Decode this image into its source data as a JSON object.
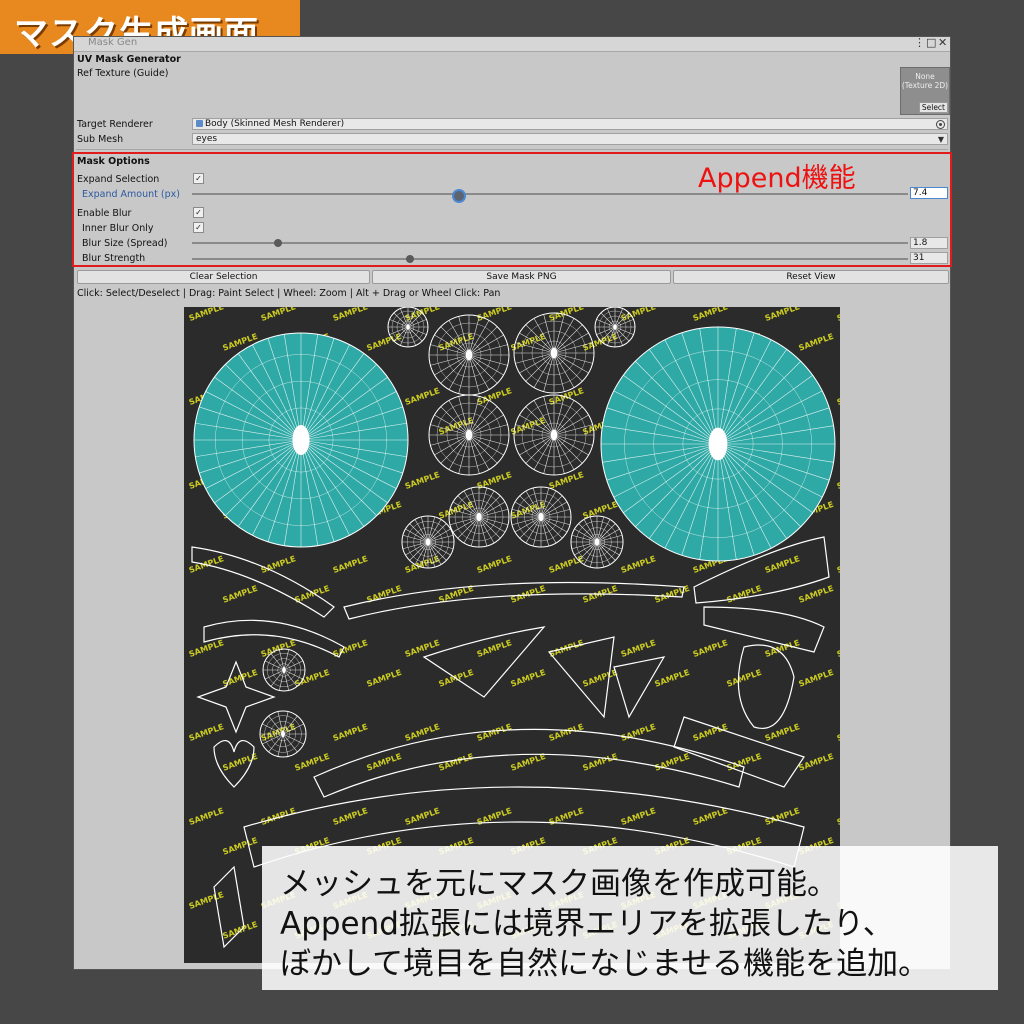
{
  "banner": {
    "title": "マスク生成画面"
  },
  "window": {
    "tab_label": "Mask Gen",
    "menu_icon": "kebab-menu-icon",
    "maximize_icon": "maximize-icon",
    "close_icon": "close-icon"
  },
  "header": {
    "title": "UV Mask Generator",
    "ref_texture_label": "Ref Texture (Guide)",
    "texture_none": "None",
    "texture_type": "(Texture 2D)",
    "texture_select": "Select"
  },
  "target": {
    "label": "Target Renderer",
    "value": "Body (Skinned Mesh Renderer)",
    "icon": "skinned-mesh-icon"
  },
  "submesh": {
    "label": "Sub Mesh",
    "value": "eyes"
  },
  "mask_options": {
    "heading": "Mask Options",
    "expand_selection_label": "Expand Selection",
    "expand_selection_checked": true,
    "expand_amount_label": "Expand Amount (px)",
    "expand_amount_value": "7.4",
    "expand_amount_fraction": 0.37,
    "enable_blur_label": "Enable Blur",
    "enable_blur_checked": true,
    "inner_blur_label": "Inner Blur Only",
    "inner_blur_checked": true,
    "blur_size_label": "Blur Size (Spread)",
    "blur_size_value": "1.8",
    "blur_size_fraction": 0.12,
    "blur_strength_label": "Blur Strength",
    "blur_strength_value": "31",
    "blur_strength_fraction": 0.305,
    "check_mark": "✓"
  },
  "annotation": {
    "append_label": "Append機能",
    "color": "#e01b1b"
  },
  "buttons": {
    "clear": "Clear Selection",
    "save": "Save Mask PNG",
    "reset": "Reset View"
  },
  "help_text": "Click: Select/Deselect  |  Drag: Paint Select  |  Wheel: Zoom  |  Alt + Drag or Wheel Click: Pan",
  "uv_view": {
    "watermark": "SAMPLE",
    "selected_color": "#2fa9a6",
    "wire_color": "#ffffff",
    "watermark_color": "#e8e821",
    "background": "#2b2b2b"
  },
  "caption": {
    "line1": "メッシュを元にマスク画像を作成可能。",
    "line2": "Append拡張には境界エリアを拡張したり、",
    "line3": "ぼかして境目を自然になじませる機能を追加。"
  }
}
